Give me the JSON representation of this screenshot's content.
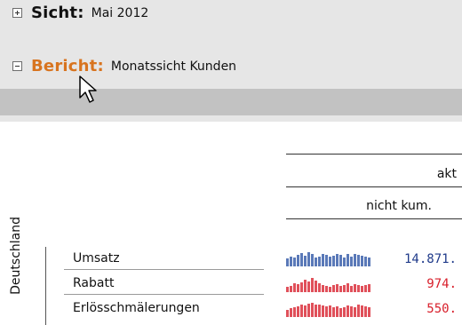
{
  "sections": {
    "sicht": {
      "label": "Sicht:",
      "value": "Mai 2012",
      "state": "collapsed"
    },
    "bericht": {
      "label": "Bericht:",
      "value": "Monatssicht Kunden",
      "state": "expanded",
      "label_color": "#d8741f"
    }
  },
  "table": {
    "column_header": "akt",
    "column_subheader": "nicht kum.",
    "group_label": "Deutschland",
    "rows": [
      {
        "label": "Umsatz",
        "value": "14.871.",
        "value_color": "#1f3a8a",
        "spark_color": "#5a79b8"
      },
      {
        "label": "Rabatt",
        "value": "974.",
        "value_color": "#d81e2a",
        "spark_color": "#e0505a"
      },
      {
        "label": "Erlösschmälerungen",
        "value": "550.",
        "value_color": "#d81e2a",
        "spark_color": "#e0505a"
      }
    ]
  },
  "icons": {
    "expand": "plus-icon",
    "collapse": "minus-icon",
    "pointer": "mouse-cursor-icon"
  }
}
